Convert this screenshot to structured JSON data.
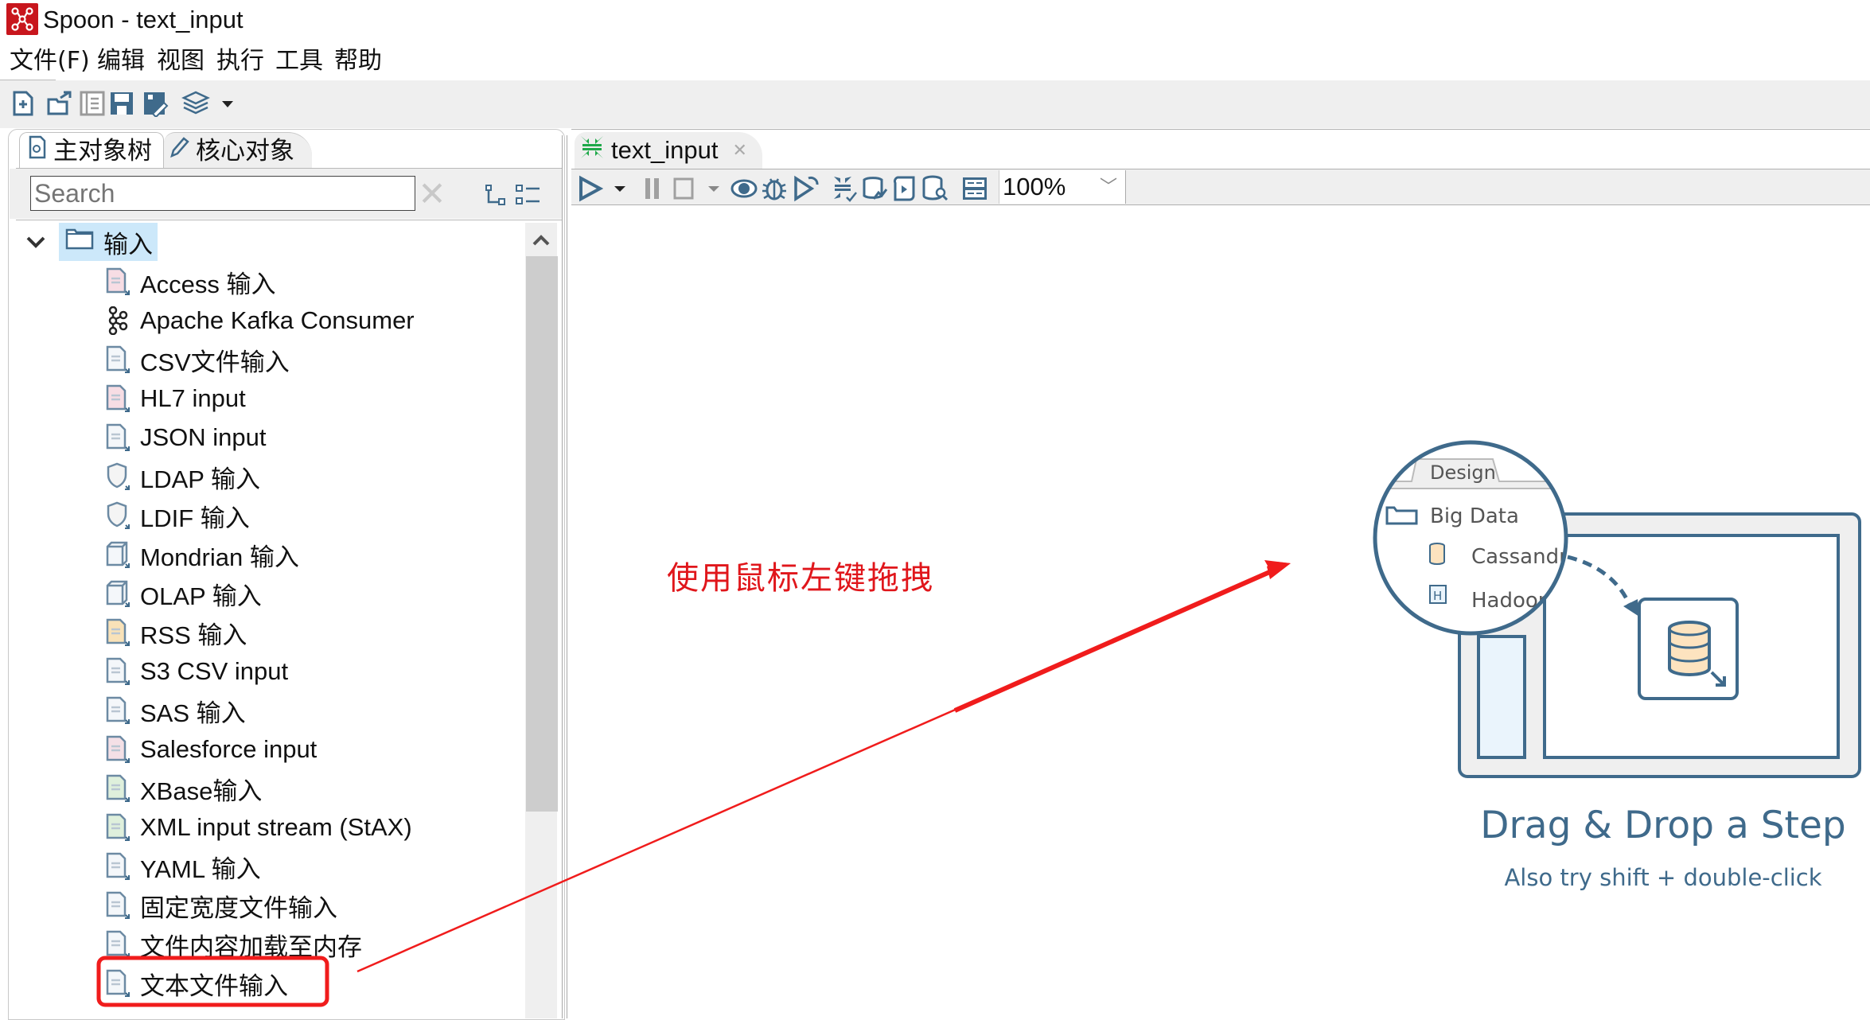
{
  "window": {
    "title": "Spoon - text_input",
    "app_icon": "spoon-icon"
  },
  "menu": [
    {
      "label": "文件(F)"
    },
    {
      "label": "编辑"
    },
    {
      "label": "视图"
    },
    {
      "label": "执行"
    },
    {
      "label": "工具"
    },
    {
      "label": "帮助"
    }
  ],
  "toolbar": {
    "icons": [
      "new-file-icon",
      "open-file-icon",
      "explore-repository-icon",
      "save-icon",
      "save-as-icon",
      "perspective-layers-icon",
      "dropdown-caret-icon"
    ]
  },
  "left_panel": {
    "tabs": [
      {
        "label": "主对象树",
        "icon": "object-tree-icon",
        "active": false
      },
      {
        "label": "核心对象",
        "icon": "pencil-icon",
        "active": true
      }
    ],
    "search": {
      "placeholder": "Search",
      "value": ""
    },
    "tree": {
      "root": {
        "label": "输入",
        "expanded": true,
        "selected": true
      },
      "items": [
        {
          "label": "Access 输入",
          "icon": "access-input-icon"
        },
        {
          "label": "Apache Kafka Consumer",
          "icon": "kafka-icon"
        },
        {
          "label": "CSV文件输入",
          "icon": "csv-file-input-icon"
        },
        {
          "label": "HL7 input",
          "icon": "hl7-input-icon"
        },
        {
          "label": "JSON input",
          "icon": "json-input-icon"
        },
        {
          "label": "LDAP 输入",
          "icon": "ldap-input-icon"
        },
        {
          "label": "LDIF 输入",
          "icon": "ldif-input-icon"
        },
        {
          "label": "Mondrian 输入",
          "icon": "mondrian-input-icon"
        },
        {
          "label": "OLAP 输入",
          "icon": "olap-input-icon"
        },
        {
          "label": "RSS 输入",
          "icon": "rss-input-icon"
        },
        {
          "label": "S3 CSV input",
          "icon": "s3-csv-input-icon"
        },
        {
          "label": "SAS 输入",
          "icon": "sas-input-icon"
        },
        {
          "label": "Salesforce input",
          "icon": "salesforce-input-icon"
        },
        {
          "label": "XBase输入",
          "icon": "xbase-input-icon"
        },
        {
          "label": "XML input stream (StAX)",
          "icon": "xml-input-stream-icon"
        },
        {
          "label": "YAML 输入",
          "icon": "yaml-input-icon"
        },
        {
          "label": "固定宽度文件输入",
          "icon": "fixed-width-input-icon"
        },
        {
          "label": "文件内容加载至内存",
          "icon": "load-file-content-icon"
        },
        {
          "label": "文本文件输入",
          "icon": "text-file-input-icon",
          "highlighted": true
        }
      ]
    }
  },
  "editor": {
    "tab": {
      "label": "text_input",
      "icon": "transformation-icon"
    },
    "toolbar_icons": [
      "run-icon",
      "run-dropdown-icon",
      "pause-icon",
      "stop-icon",
      "stop-dropdown-icon",
      "preview-icon",
      "debug-icon",
      "replay-icon",
      "verify-icon",
      "impact-analysis-icon",
      "sql-icon",
      "explore-db-icon",
      "align-distribute-icon"
    ],
    "zoom": {
      "value": "100%"
    },
    "hint": {
      "title": "Drag & Drop a Step",
      "subtitle": "Also try shift + double-click",
      "illustration": {
        "tab_label": "Design",
        "folder_label": "Big Data",
        "items": [
          "Cassandr",
          "Hadoop"
        ]
      }
    }
  },
  "annotation": {
    "text": "使用鼠标左键拖拽",
    "color": "#e0161b"
  },
  "colors": {
    "accent_blue": "#3f6a8b",
    "selection_bg": "#cce8fa",
    "chrome_gray": "#efefef",
    "annotation_red": "#e0161b"
  }
}
